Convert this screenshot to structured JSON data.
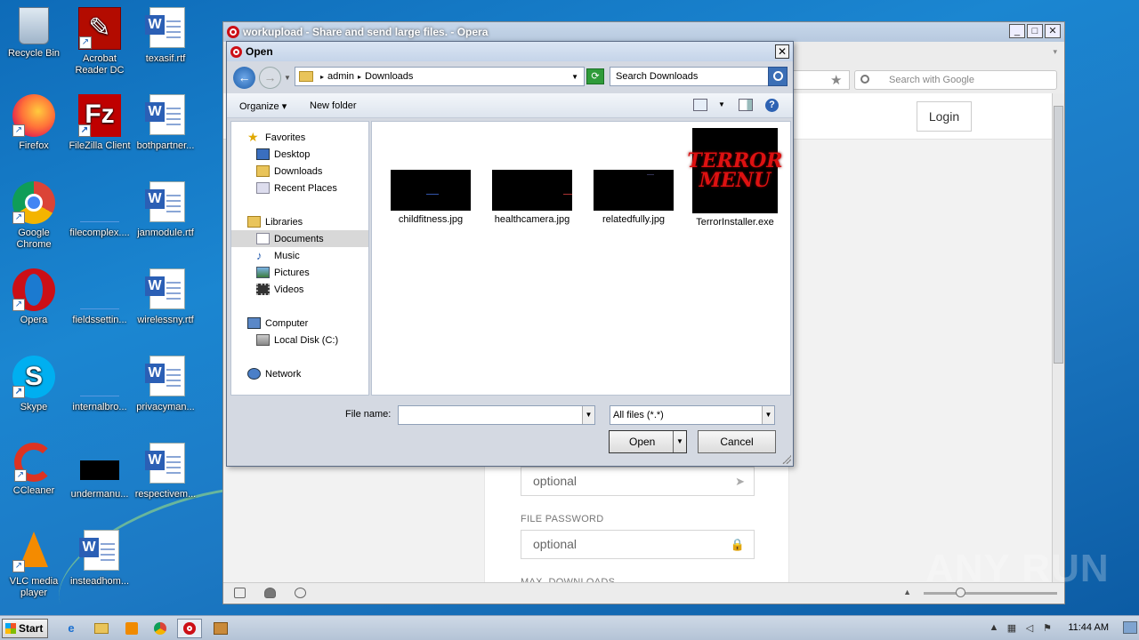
{
  "desktop": {
    "icons": [
      {
        "label": "Recycle Bin",
        "icon": "recycle-bin-icon"
      },
      {
        "label": "Acrobat Reader DC",
        "icon": "acrobat-icon"
      },
      {
        "label": "texasif.rtf",
        "icon": "word-doc-icon"
      },
      {
        "label": "Firefox",
        "icon": "firefox-icon"
      },
      {
        "label": "FileZilla Client",
        "icon": "filezilla-icon"
      },
      {
        "label": "bothpartner...",
        "icon": "word-doc-icon"
      },
      {
        "label": "Google Chrome",
        "icon": "chrome-icon"
      },
      {
        "label": "filecomplex....",
        "icon": "blank-file-icon"
      },
      {
        "label": "janmodule.rtf",
        "icon": "word-doc-icon"
      },
      {
        "label": "Opera",
        "icon": "opera-icon"
      },
      {
        "label": "fieldssettin...",
        "icon": "blank-file-icon"
      },
      {
        "label": "wirelessny.rtf",
        "icon": "word-doc-icon"
      },
      {
        "label": "Skype",
        "icon": "skype-icon"
      },
      {
        "label": "internalbro...",
        "icon": "blank-file-icon"
      },
      {
        "label": "privacyman...",
        "icon": "word-doc-icon"
      },
      {
        "label": "CCleaner",
        "icon": "ccleaner-icon"
      },
      {
        "label": "undermanu...",
        "icon": "black-image-icon"
      },
      {
        "label": "respectivem...",
        "icon": "word-doc-icon"
      },
      {
        "label": "VLC media player",
        "icon": "vlc-icon"
      },
      {
        "label": "insteadhom...",
        "icon": "word-doc-icon"
      }
    ]
  },
  "browser": {
    "title": "workupload - Share and send large files. - Opera",
    "search_placeholder": "Search with Google",
    "login_label": "Login",
    "upload_form": {
      "field1_value": "optional",
      "password_label": "FILE PASSWORD",
      "password_value": "optional",
      "max_downloads_label": "MAX. DOWNLOADS"
    }
  },
  "dialog": {
    "title": "Open",
    "breadcrumb": [
      "admin",
      "Downloads"
    ],
    "search_placeholder": "Search Downloads",
    "organize_label": "Organize",
    "new_folder_label": "New folder",
    "nav": {
      "favorites": "Favorites",
      "desktop": "Desktop",
      "downloads": "Downloads",
      "recent": "Recent Places",
      "libraries": "Libraries",
      "documents": "Documents",
      "music": "Music",
      "pictures": "Pictures",
      "videos": "Videos",
      "computer": "Computer",
      "local_disk": "Local Disk (C:)",
      "network": "Network"
    },
    "files": [
      {
        "name": "childfitness.jpg"
      },
      {
        "name": "healthcamera.jpg"
      },
      {
        "name": "relatedfully.jpg"
      },
      {
        "name": "TerrorInstaller.exe",
        "thumb_text": [
          "TERROR",
          "MENU"
        ]
      }
    ],
    "file_name_label": "File name:",
    "file_name_value": "",
    "file_type": "All files (*.*)",
    "open_label": "Open",
    "cancel_label": "Cancel"
  },
  "watermark": "ANY RUN",
  "taskbar": {
    "start_label": "Start",
    "clock": "11:44 AM"
  }
}
